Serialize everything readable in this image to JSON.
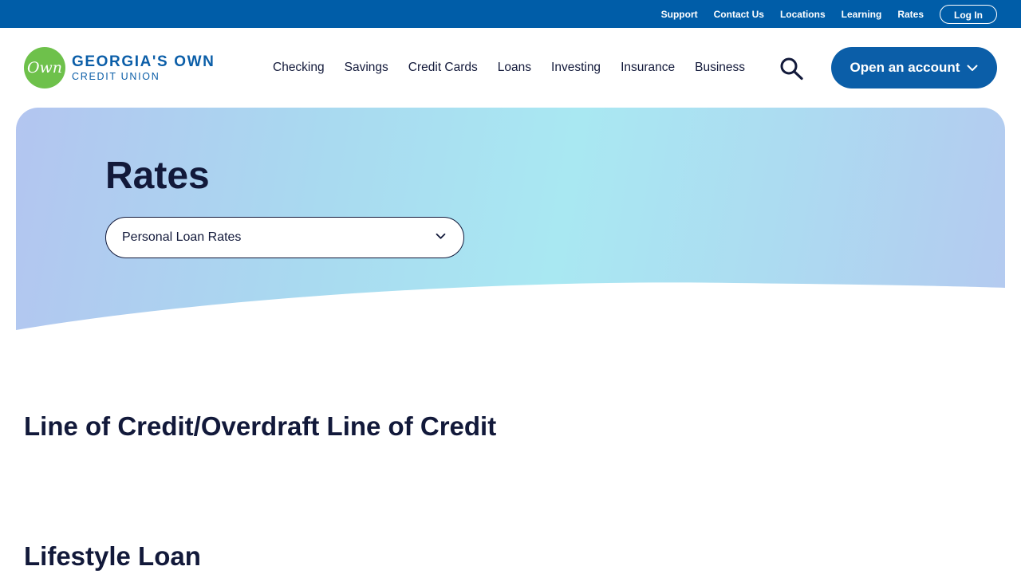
{
  "utility_nav": {
    "links": [
      "Support",
      "Contact Us",
      "Locations",
      "Learning",
      "Rates"
    ],
    "login_label": "Log In"
  },
  "logo": {
    "badge_text": "Own",
    "line1": "GEORGIA'S OWN",
    "line2": "CREDIT UNION"
  },
  "main_nav": {
    "items": [
      "Checking",
      "Savings",
      "Credit Cards",
      "Loans",
      "Investing",
      "Insurance",
      "Business"
    ],
    "search_icon": "search-icon",
    "open_account_label": "Open an account"
  },
  "hero": {
    "title": "Rates",
    "select_value": "Personal Loan Rates"
  },
  "sections": [
    {
      "title": "Line of Credit/Overdraft Line of Credit"
    },
    {
      "title": "Lifestyle Loan"
    }
  ],
  "colors": {
    "utility_bar": "#005da8",
    "brand_blue": "#0b5ea8",
    "brand_green": "#6ec14b",
    "text_navy": "#12193a"
  }
}
